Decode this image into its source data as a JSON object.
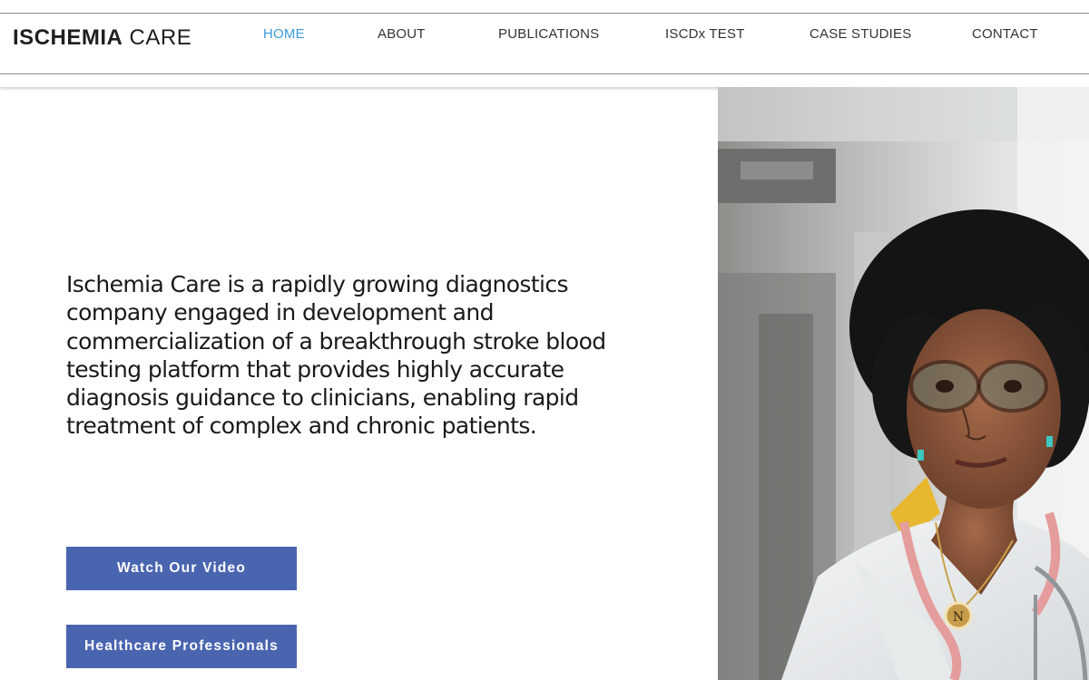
{
  "brand": {
    "logo_bold": "ISCHEMIA",
    "logo_light": "CARE",
    "accent_color": "#1f6f8b"
  },
  "nav": {
    "items": [
      {
        "label": "HOME",
        "active": true
      },
      {
        "label": "ABOUT",
        "active": false
      },
      {
        "label": "PUBLICATIONS",
        "active": false
      },
      {
        "label": "ISCDx TEST",
        "active": false
      },
      {
        "label": "CASE STUDIES",
        "active": false
      },
      {
        "label": "CONTACT",
        "active": false
      }
    ],
    "active_color": "#3d9bd9"
  },
  "hero": {
    "intro": "Ischemia Care is a rapidly growing diagnostics company engaged in development and commercialization of a breakthrough stroke blood testing platform that provides highly accurate diagnosis guidance to clinicians, enabling rapid treatment of complex and chronic patients.",
    "buttons": {
      "watch_video": "Watch Our Video",
      "healthcare": "Healthcare Professionals"
    },
    "button_color": "#4a65b0"
  },
  "photo": {
    "icon": "doctor-portrait-photo",
    "pendant_letter": "N"
  }
}
